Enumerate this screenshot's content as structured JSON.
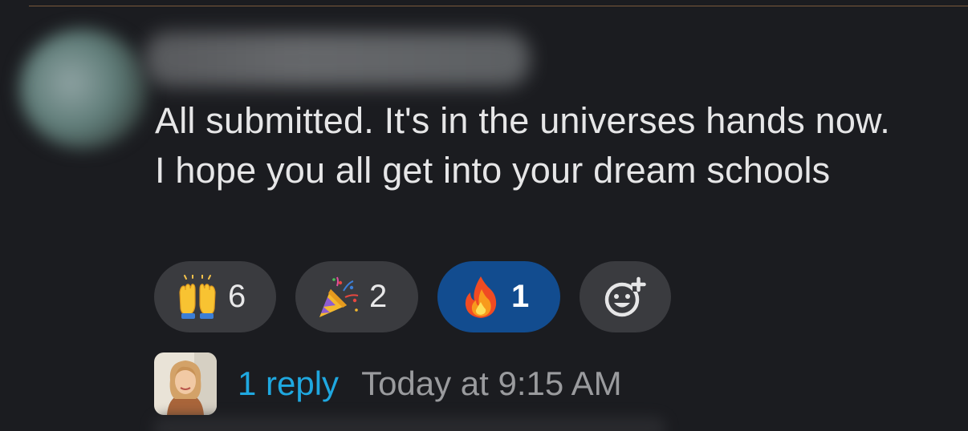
{
  "message": {
    "text": "All submitted. It's in the universes hands now. I hope you all get into your dream schools"
  },
  "reactions": [
    {
      "emoji": "raising-hands",
      "count": "6",
      "selected": false
    },
    {
      "emoji": "party-popper",
      "count": "2",
      "selected": false
    },
    {
      "emoji": "fire",
      "count": "1",
      "selected": true
    }
  ],
  "add_reaction": {
    "icon": "add-reaction-icon"
  },
  "thread": {
    "reply_label": "1 reply",
    "timestamp": "Today at 9:15 AM"
  },
  "colors": {
    "background": "#1b1c20",
    "pill": "#3a3b3f",
    "pill_selected": "#124c8f",
    "link": "#1fa8e0"
  }
}
